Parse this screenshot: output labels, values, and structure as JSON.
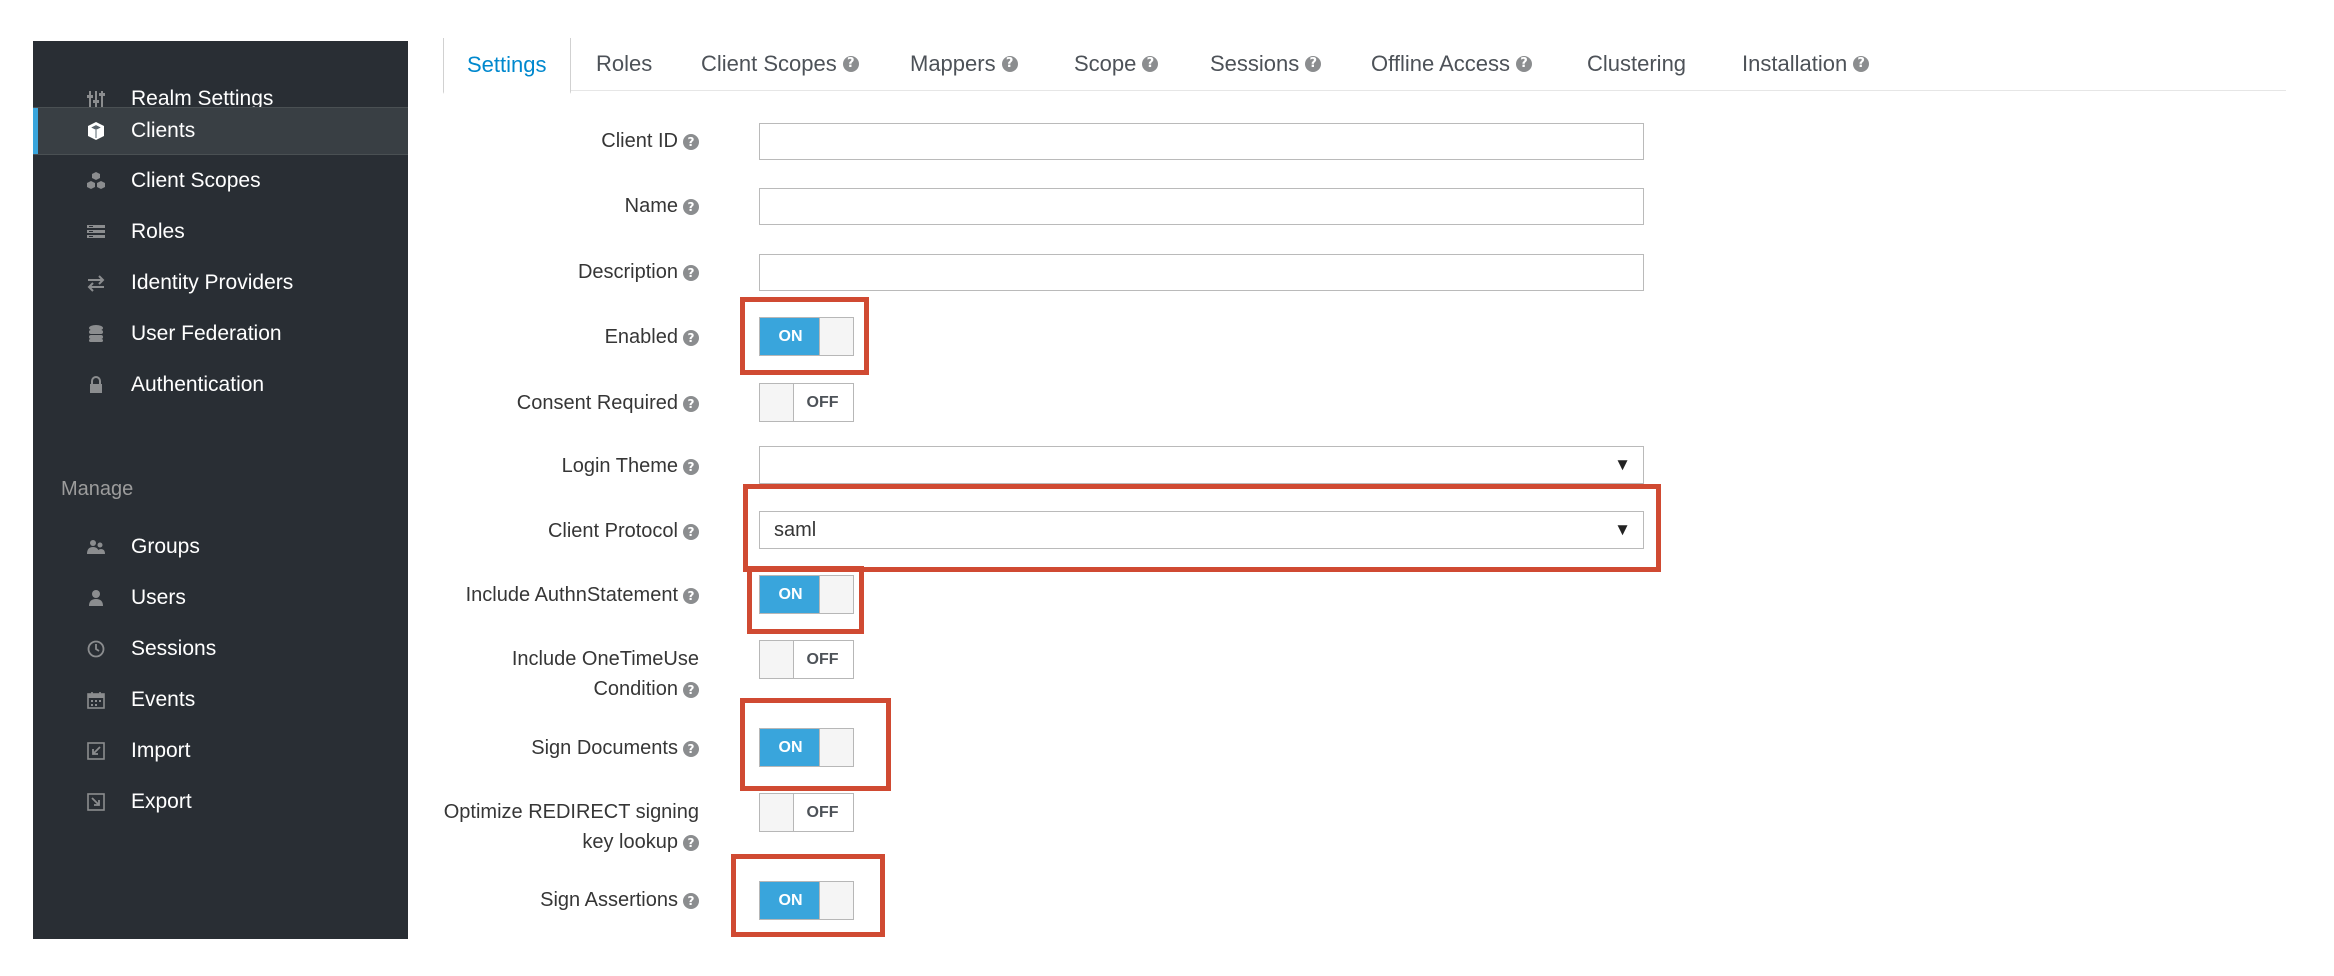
{
  "sidebar": {
    "items": [
      {
        "label": "Realm Settings",
        "icon": "sliders-icon"
      },
      {
        "label": "Clients",
        "icon": "cube-icon"
      },
      {
        "label": "Client Scopes",
        "icon": "cubes-icon"
      },
      {
        "label": "Roles",
        "icon": "roles-icon"
      },
      {
        "label": "Identity Providers",
        "icon": "exchange-icon"
      },
      {
        "label": "User Federation",
        "icon": "database-icon"
      },
      {
        "label": "Authentication",
        "icon": "lock-icon"
      }
    ],
    "manage_label": "Manage",
    "manage_items": [
      {
        "label": "Groups",
        "icon": "groups-icon"
      },
      {
        "label": "Users",
        "icon": "user-icon"
      },
      {
        "label": "Sessions",
        "icon": "clock-icon"
      },
      {
        "label": "Events",
        "icon": "calendar-icon"
      },
      {
        "label": "Import",
        "icon": "import-icon"
      },
      {
        "label": "Export",
        "icon": "export-icon"
      }
    ],
    "active": "Clients"
  },
  "tabs": [
    {
      "label": "Settings",
      "help": false
    },
    {
      "label": "Roles",
      "help": false
    },
    {
      "label": "Client Scopes",
      "help": true
    },
    {
      "label": "Mappers",
      "help": true
    },
    {
      "label": "Scope",
      "help": true
    },
    {
      "label": "Sessions",
      "help": true
    },
    {
      "label": "Offline Access",
      "help": true
    },
    {
      "label": "Clustering",
      "help": false
    },
    {
      "label": "Installation",
      "help": true
    }
  ],
  "help_glyph": "?",
  "form": {
    "client_id": {
      "label": "Client ID",
      "value": ""
    },
    "name": {
      "label": "Name",
      "value": ""
    },
    "description": {
      "label": "Description",
      "value": ""
    },
    "enabled": {
      "label": "Enabled",
      "state": "ON"
    },
    "consent_required": {
      "label": "Consent Required",
      "state": "OFF"
    },
    "login_theme": {
      "label": "Login Theme",
      "value": ""
    },
    "client_protocol": {
      "label": "Client Protocol",
      "value": "saml"
    },
    "include_authn_statement": {
      "label": "Include AuthnStatement",
      "state": "ON"
    },
    "include_onetimeuse": {
      "label_line1": "Include OneTimeUse",
      "label_line2": "Condition",
      "state": "OFF"
    },
    "sign_documents": {
      "label": "Sign Documents",
      "state": "ON"
    },
    "optimize_redirect": {
      "label_line1": "Optimize REDIRECT signing",
      "label_line2": "key lookup",
      "state": "OFF"
    },
    "sign_assertions": {
      "label": "Sign Assertions",
      "state": "ON"
    }
  },
  "caret": "▼",
  "highlight_color": "#d04a32",
  "accent_color": "#39a5dc"
}
